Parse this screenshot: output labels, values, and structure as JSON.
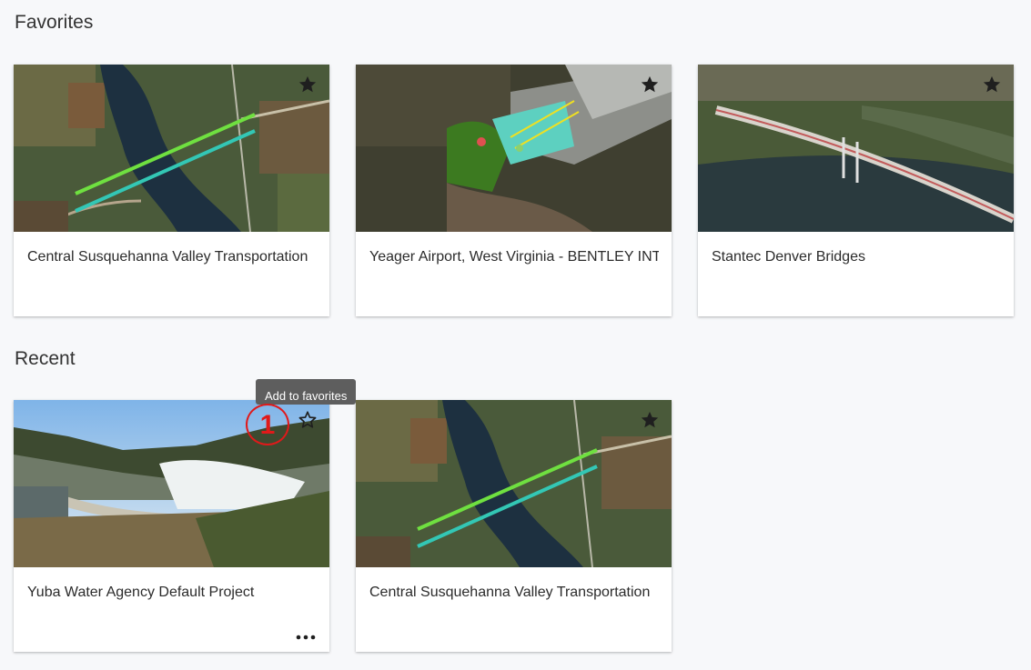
{
  "favorites": {
    "title": "Favorites",
    "cards": [
      {
        "name": "Central Susquehanna Valley Transportation",
        "favorite": true
      },
      {
        "name": "Yeager Airport, West Virginia - BENTLEY INTERNAL",
        "favorite": true
      },
      {
        "name": "Stantec Denver Bridges",
        "favorite": true
      }
    ]
  },
  "recent": {
    "title": "Recent",
    "cards": [
      {
        "name": "Yuba Water Agency Default Project",
        "favorite": false
      },
      {
        "name": "Central Susquehanna Valley Transportation",
        "favorite": true
      }
    ]
  },
  "tooltip": {
    "text": "Add to favorites"
  },
  "callout": {
    "number": "1"
  },
  "icons": {
    "star_filled": "star-filled-icon",
    "star_outline": "star-outline-icon",
    "more": "more-horizontal-icon"
  },
  "colors": {
    "callout": "#e0191a",
    "tooltip_bg": "#5e5e5e",
    "page_bg": "#f7f8fa"
  }
}
